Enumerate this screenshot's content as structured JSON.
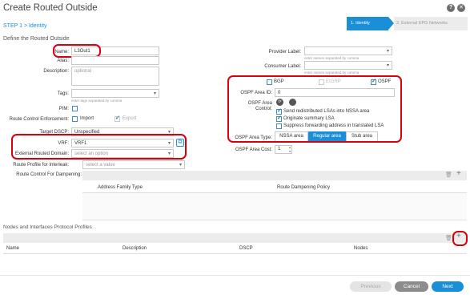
{
  "dialog": {
    "title": "Create Routed Outside",
    "step_label": "STEP 1 > Identity",
    "section_title": "Define the Routed Outside"
  },
  "wizard": {
    "step1": "1. Identity",
    "step2": "2. External EPG Networks"
  },
  "form": {
    "name_label": "Name:",
    "name_value": "L3Out1",
    "alias_label": "Alias:",
    "description_label": "Description:",
    "description_placeholder": "optional",
    "tags_label": "Tags:",
    "tags_hint": "enter tags separated by comma",
    "pim_label": "PIM:",
    "route_control_label": "Route Control Enforcement:",
    "import_label": "Import",
    "export_label": "Export",
    "target_dscp_label": "Target DSCP:",
    "target_dscp_value": "Unspecified",
    "vrf_label": "VRF:",
    "vrf_value": "VRF1",
    "ext_domain_label": "External Routed Domain:",
    "ext_domain_placeholder": "select an option",
    "route_profile_label": "Route Profile for Interleak:",
    "route_profile_placeholder": "select a value",
    "dampening_label": "Route Control For Dampening:",
    "dampening_col1": "Address Family Type",
    "dampening_col2": "Route Dampening Policy"
  },
  "right": {
    "provider_label": "Provider Label:",
    "provider_hint": "enter names separated by comma",
    "consumer_label": "Consumer Label:",
    "consumer_hint": "enter names separated by comma",
    "proto_bgp": "BGP",
    "proto_eigrp": "EIGRP",
    "proto_ospf": "OSPF",
    "area_id_label": "OSPF Area ID:",
    "area_id_value": "0",
    "area_control_label1": "OSPF Area",
    "area_control_label2": "Control:",
    "opt1": "Send redistributed LSAs into NSSA area",
    "opt2": "Originate summary LSA",
    "opt3": "Suppress forwarding address in translated LSA",
    "area_type_label": "OSPF Area Type:",
    "area_types": [
      "NSSA area",
      "Regular area",
      "Stub area"
    ],
    "area_cost_label": "OSPF Area Cost:",
    "area_cost_value": "1"
  },
  "nodes": {
    "title": "Nodes and Interfaces Protocol Profiles",
    "cols": [
      "Name",
      "Description",
      "DSCP",
      "Nodes"
    ]
  },
  "buttons": {
    "previous": "Previous",
    "cancel": "Cancel",
    "next": "Next"
  },
  "colors": {
    "accent": "#1a8fd7",
    "annotation": "#d9000d"
  }
}
